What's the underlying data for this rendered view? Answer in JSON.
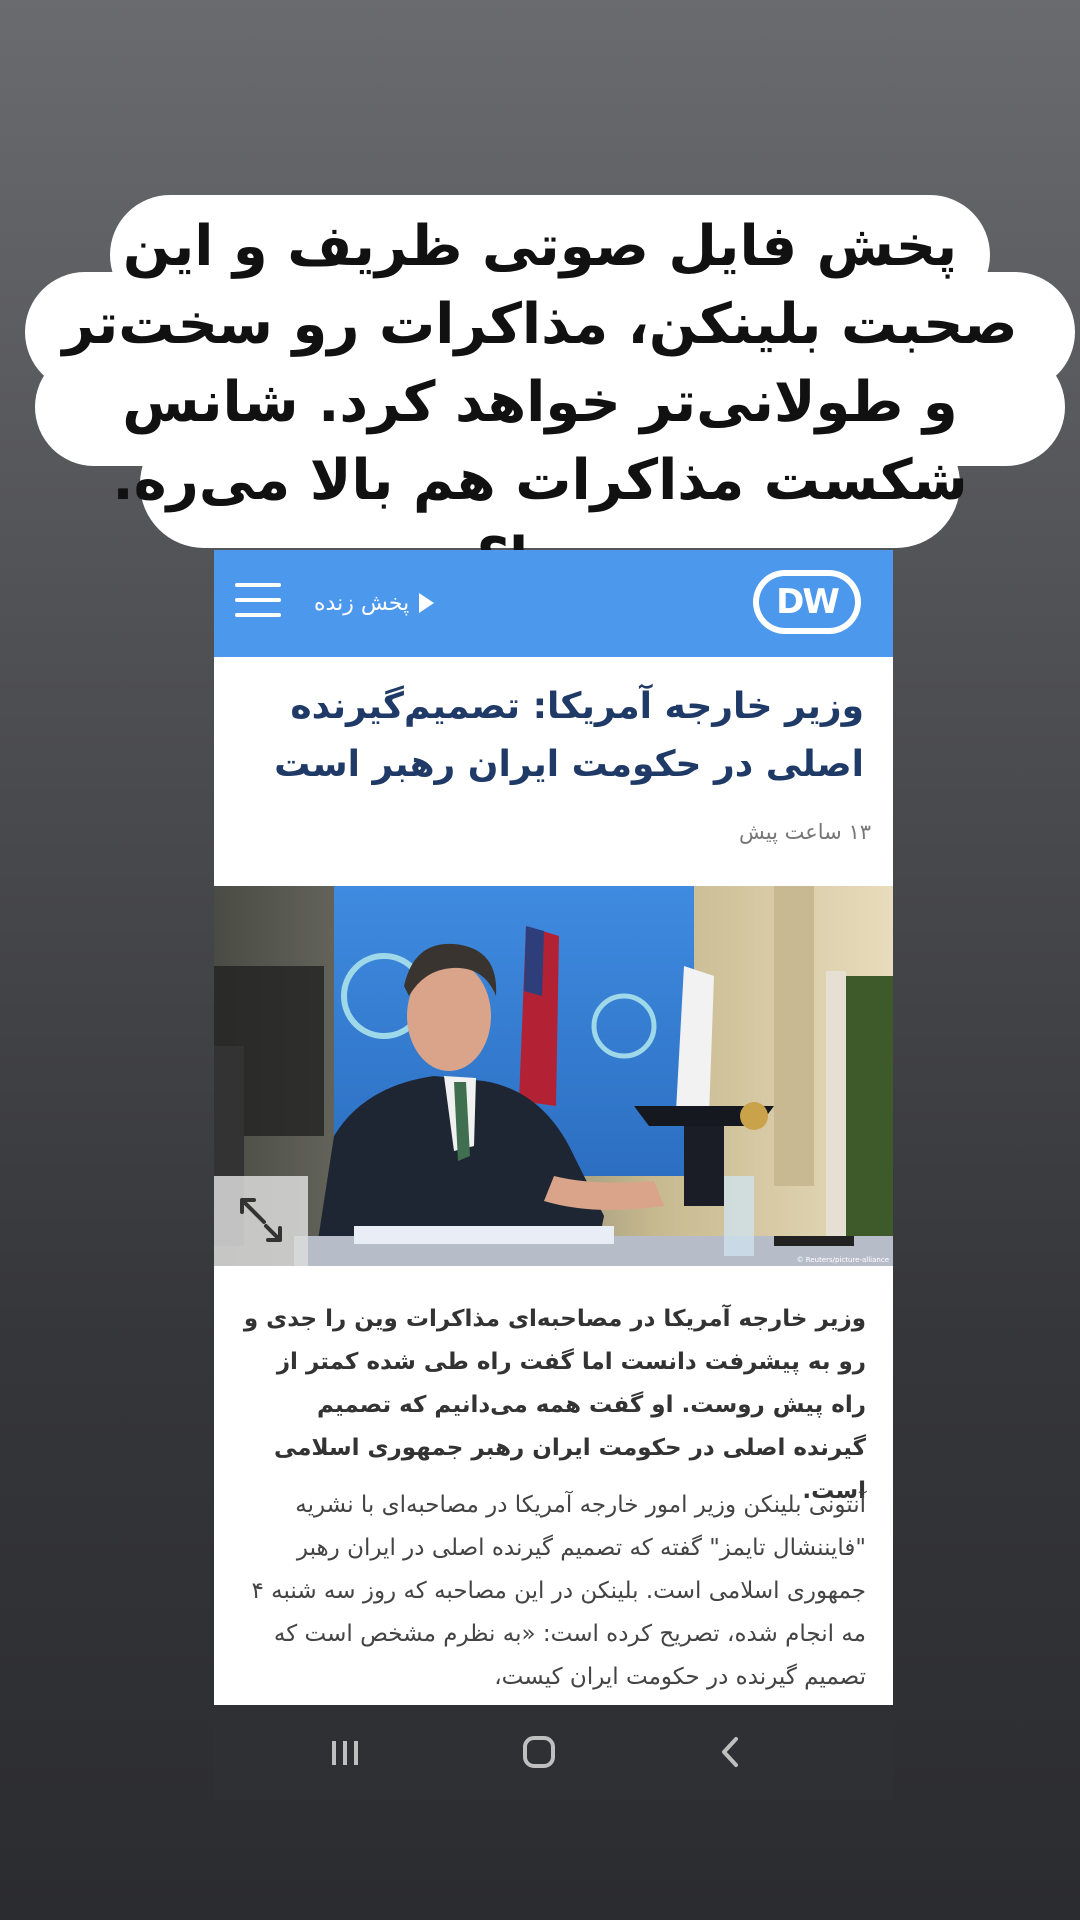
{
  "caption": {
    "text": "پخش فایل صوتی ظریف و این صحبت بلینکن، مذاکرات رو سخت‌تر و طولانی‌تر خواهد کرد. شانس شکست مذاکرات هم بالا می‌ره. چرا؟"
  },
  "app": {
    "live_label": "پخش زنده",
    "logo_text": "DW",
    "accent_color": "#4b98ec"
  },
  "article": {
    "headline": "وزیر خارجه آمریکا: تصمیم‌گیرنده اصلی در حکومت ایران رهبر است",
    "timestamp": "۱۳ ساعت پیش",
    "photo_credit": "© Reuters/picture-alliance",
    "lead": "وزیر خارجه آمریکا در مصاحبه‌ای مذاکرات وین را جدی و رو به پیشرفت دانست اما گفت راه طی شده کمتر از راه پیش روست. او گفت همه می‌دانیم که تصمیم گیرنده اصلی در حکومت ایران رهبر جمهوری اسلامی است.",
    "body": "آنتونی بلینکن وزیر امور خارجه آمریکا در مصاحبه‌ای با نشریه \"فایننشال تایمز\" گفته که تصمیم گیرنده اصلی در ایران رهبر جمهوری اسلامی است. بلینکن در این مصاحبه که روز سه شنبه ۴ مه انجام شده، تصریح کرده است: «به نظرم مشخص است که تصمیم گیرنده در حکومت ایران کیست،"
  },
  "icons": {
    "menu": "hamburger-menu-icon",
    "play": "play-icon",
    "expand": "expand-icon",
    "recents": "recents-icon",
    "home": "home-icon",
    "back": "back-icon"
  }
}
